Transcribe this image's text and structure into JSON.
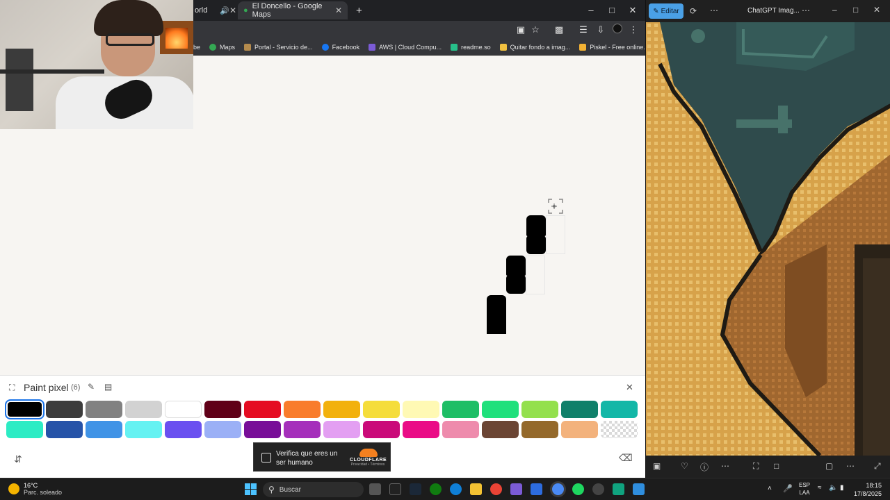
{
  "browser": {
    "tabs": [
      {
        "label": "orld",
        "active": false
      },
      {
        "label": "El Doncello - Google Maps",
        "active": true
      }
    ],
    "new_tab_symbol": "+",
    "bookmarks": [
      {
        "label": "be",
        "color": "#e33"
      },
      {
        "label": "Maps",
        "color": "#34a853"
      },
      {
        "label": "Portal - Servicio de...",
        "color": "#b58b4d"
      },
      {
        "label": "Facebook",
        "color": "#1877f2"
      },
      {
        "label": "AWS | Cloud Compu...",
        "color": "#7b5bd6"
      },
      {
        "label": "readme.so",
        "color": "#27c08a"
      },
      {
        "label": "Quitar fondo a imag...",
        "color": "#f0c040"
      },
      {
        "label": "Piskel - Free online...",
        "color": "#f2b134"
      }
    ]
  },
  "panel": {
    "title": "Paint pixel",
    "count": "(6)",
    "colors_row1": [
      "#000000",
      "#3c3c3c",
      "#818181",
      "#d2d2d2",
      "#ffffff",
      "#600018",
      "#e50c22",
      "#f97c2c",
      "#f2b10d",
      "#f5dd3b",
      "#fff9b4",
      "#1ebe66",
      "#20e07c",
      "#94e04d",
      "#10806a",
      "#13b7a7"
    ],
    "colors_row2": [
      "#2cecc4",
      "#2653a8",
      "#4093e6",
      "#65f2f2",
      "#6a50f0",
      "#9bb0f6",
      "#780e98",
      "#a52fbb",
      "#e39ff2",
      "#ca0a79",
      "#ea0c86",
      "#ee8bac",
      "#6b4534",
      "#94692b",
      "#f3b27c",
      "transparent"
    ],
    "selected_index": 0
  },
  "captcha": {
    "text": "Verifica que eres un ser humano",
    "brand": "CLOUDFLARE",
    "links": "Privacidad • Términos"
  },
  "photos": {
    "edit_label": "Editar",
    "title": "ChatGPT Imag..."
  },
  "taskbar": {
    "temperature": "16°C",
    "weather": "Parc. soleado",
    "search_placeholder": "Buscar",
    "lang_line1": "ESP",
    "lang_line2": "LAA",
    "time": "18:15",
    "date": "17/8/2025"
  }
}
